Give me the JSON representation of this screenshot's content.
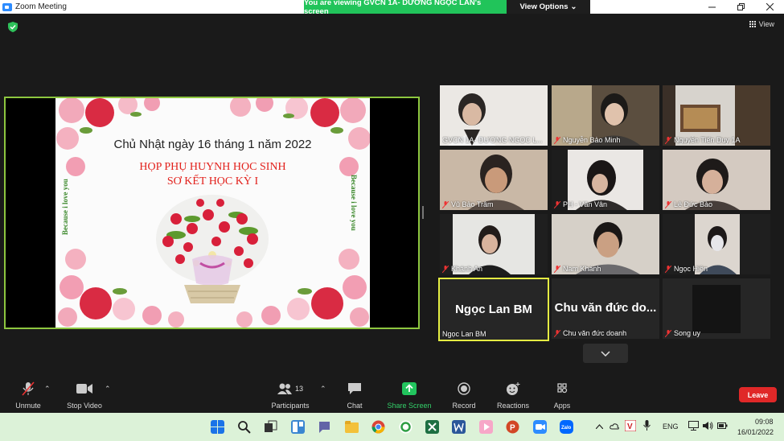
{
  "window": {
    "title": "Zoom Meeting"
  },
  "banner": {
    "text": "You are viewing GVCN 1A- DƯƠNG NGỌC LAN's screen",
    "view_options": "View Options"
  },
  "topbar": {
    "view_label": "View"
  },
  "slide": {
    "date": "Chủ Nhật ngày 16 tháng 1 năm 2022",
    "title_line1": "HỌP PHỤ HUYNH HỌC SINH",
    "title_line2": "SƠ KẾT HỌC KỲ I",
    "side_left": "Because i love you",
    "side_right": "Because i love you"
  },
  "participants": [
    {
      "name": "GVCN 1A- DƯƠNG NGỌC L...",
      "muted": false
    },
    {
      "name": "Nguyễn Bảo Minh",
      "muted": true
    },
    {
      "name": "Nguyễn Tiến Duy 1A",
      "muted": true
    },
    {
      "name": "Vũ Bảo Trâm",
      "muted": true
    },
    {
      "name": "PH - Vân Vân",
      "muted": true
    },
    {
      "name": "Lê Đức Bảo",
      "muted": true
    },
    {
      "name": "Khánh An",
      "muted": true
    },
    {
      "name": "Nam Khánh",
      "muted": true
    },
    {
      "name": "Ngọc Hiền",
      "muted": true
    },
    {
      "name": "Ngọc Lan BM",
      "big": "Ngọc Lan BM",
      "muted": false
    },
    {
      "name": "Chu văn đức doanh",
      "big": "Chu văn đức do...",
      "muted": true
    },
    {
      "name": "Song uy",
      "muted": true
    }
  ],
  "toolbar": {
    "unmute": "Unmute",
    "stop_video": "Stop Video",
    "participants": "Participants",
    "participants_count": "13",
    "chat": "Chat",
    "share_screen": "Share Screen",
    "record": "Record",
    "reactions": "Reactions",
    "apps": "Apps",
    "leave": "Leave"
  },
  "taskbar": {
    "language": "ENG",
    "time": "09:08",
    "date": "16/01/2022"
  },
  "colors": {
    "share_green": "#21c45a",
    "active_speaker": "#e5ef43",
    "leave_red": "#e02828",
    "share_border": "#8dc63f"
  }
}
